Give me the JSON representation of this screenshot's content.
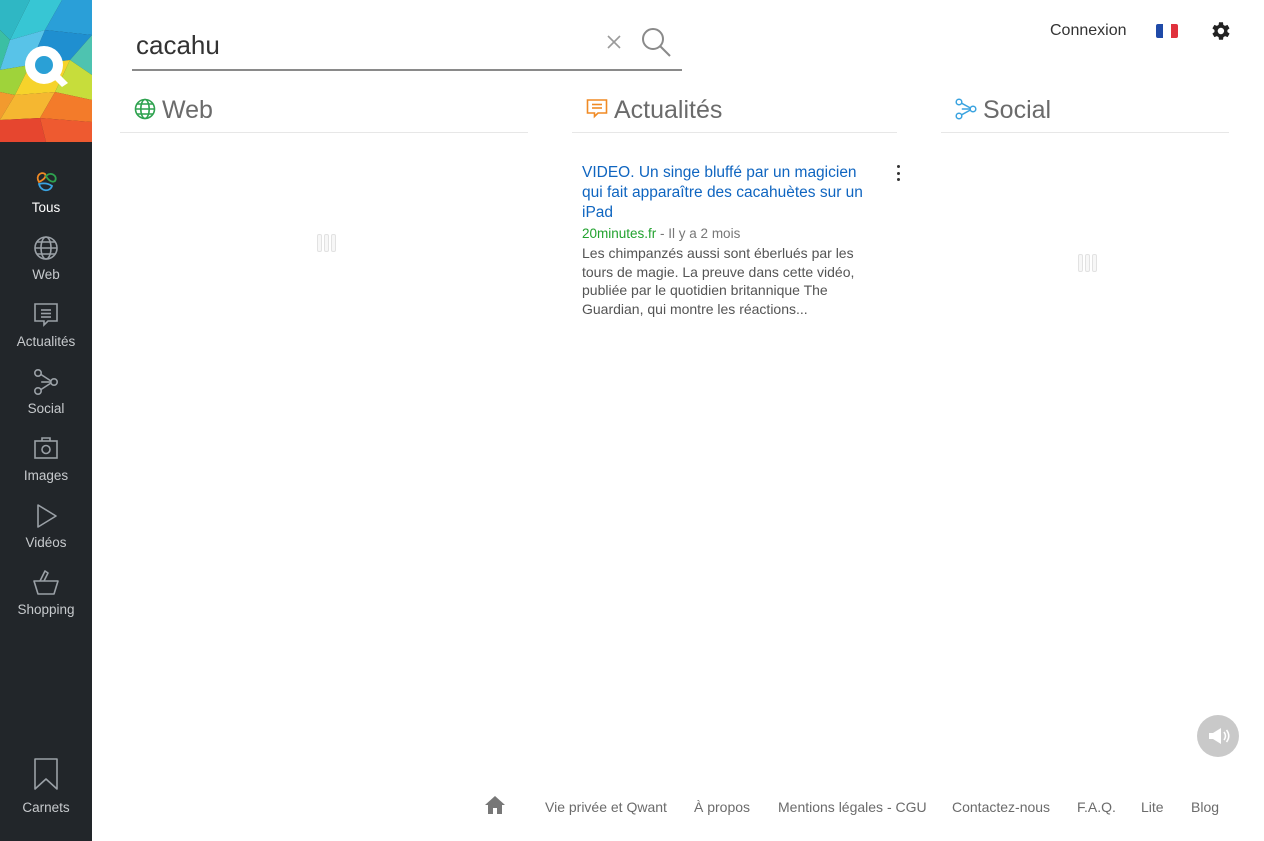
{
  "search": {
    "query": "cacahu",
    "clear_icon": "close-icon",
    "submit_icon": "search-icon"
  },
  "header": {
    "login_label": "Connexion",
    "language_flag": "fr-flag-icon",
    "settings_icon": "gear-icon"
  },
  "sidebar": {
    "logo": "qwant-logo",
    "items": [
      {
        "label": "Tous",
        "icon": "all-icon",
        "active": true
      },
      {
        "label": "Web",
        "icon": "globe-icon",
        "active": false
      },
      {
        "label": "Actualités",
        "icon": "news-icon",
        "active": false
      },
      {
        "label": "Social",
        "icon": "social-icon",
        "active": false
      },
      {
        "label": "Images",
        "icon": "camera-icon",
        "active": false
      },
      {
        "label": "Vidéos",
        "icon": "play-icon",
        "active": false
      },
      {
        "label": "Shopping",
        "icon": "basket-icon",
        "active": false
      }
    ],
    "bottom_item": {
      "label": "Carnets",
      "icon": "bookmark-icon"
    }
  },
  "columns": {
    "web": {
      "title": "Web",
      "icon": "globe-icon",
      "color": "#2ea24f"
    },
    "news": {
      "title": "Actualités",
      "icon": "news-icon",
      "color": "#f08a24"
    },
    "social": {
      "title": "Social",
      "icon": "social-icon",
      "color": "#3aa3e0"
    }
  },
  "news_results": [
    {
      "title": "VIDEO. Un singe bluffé par un magicien qui fait apparaître des cacahuètes sur un iPad",
      "source": "20minutes.fr",
      "separator": " - ",
      "time": "Il y a 2 mois",
      "description": "Les chimpanzés aussi sont éberlués par les tours de magie. La preuve dans cette vidéo, publiée par le quotidien britannique The Guardian, qui montre les réactions..."
    }
  ],
  "feedback_icon": "megaphone-icon",
  "footer": {
    "home_icon": "home-icon",
    "links": [
      "Vie privée et Qwant",
      "À propos",
      "Mentions légales - CGU",
      "Contactez-nous",
      "F.A.Q.",
      "Lite",
      "Blog"
    ]
  },
  "colors": {
    "sidebar_bg": "#22262a",
    "link_blue": "#0f65c0",
    "source_green": "#22a22f"
  }
}
